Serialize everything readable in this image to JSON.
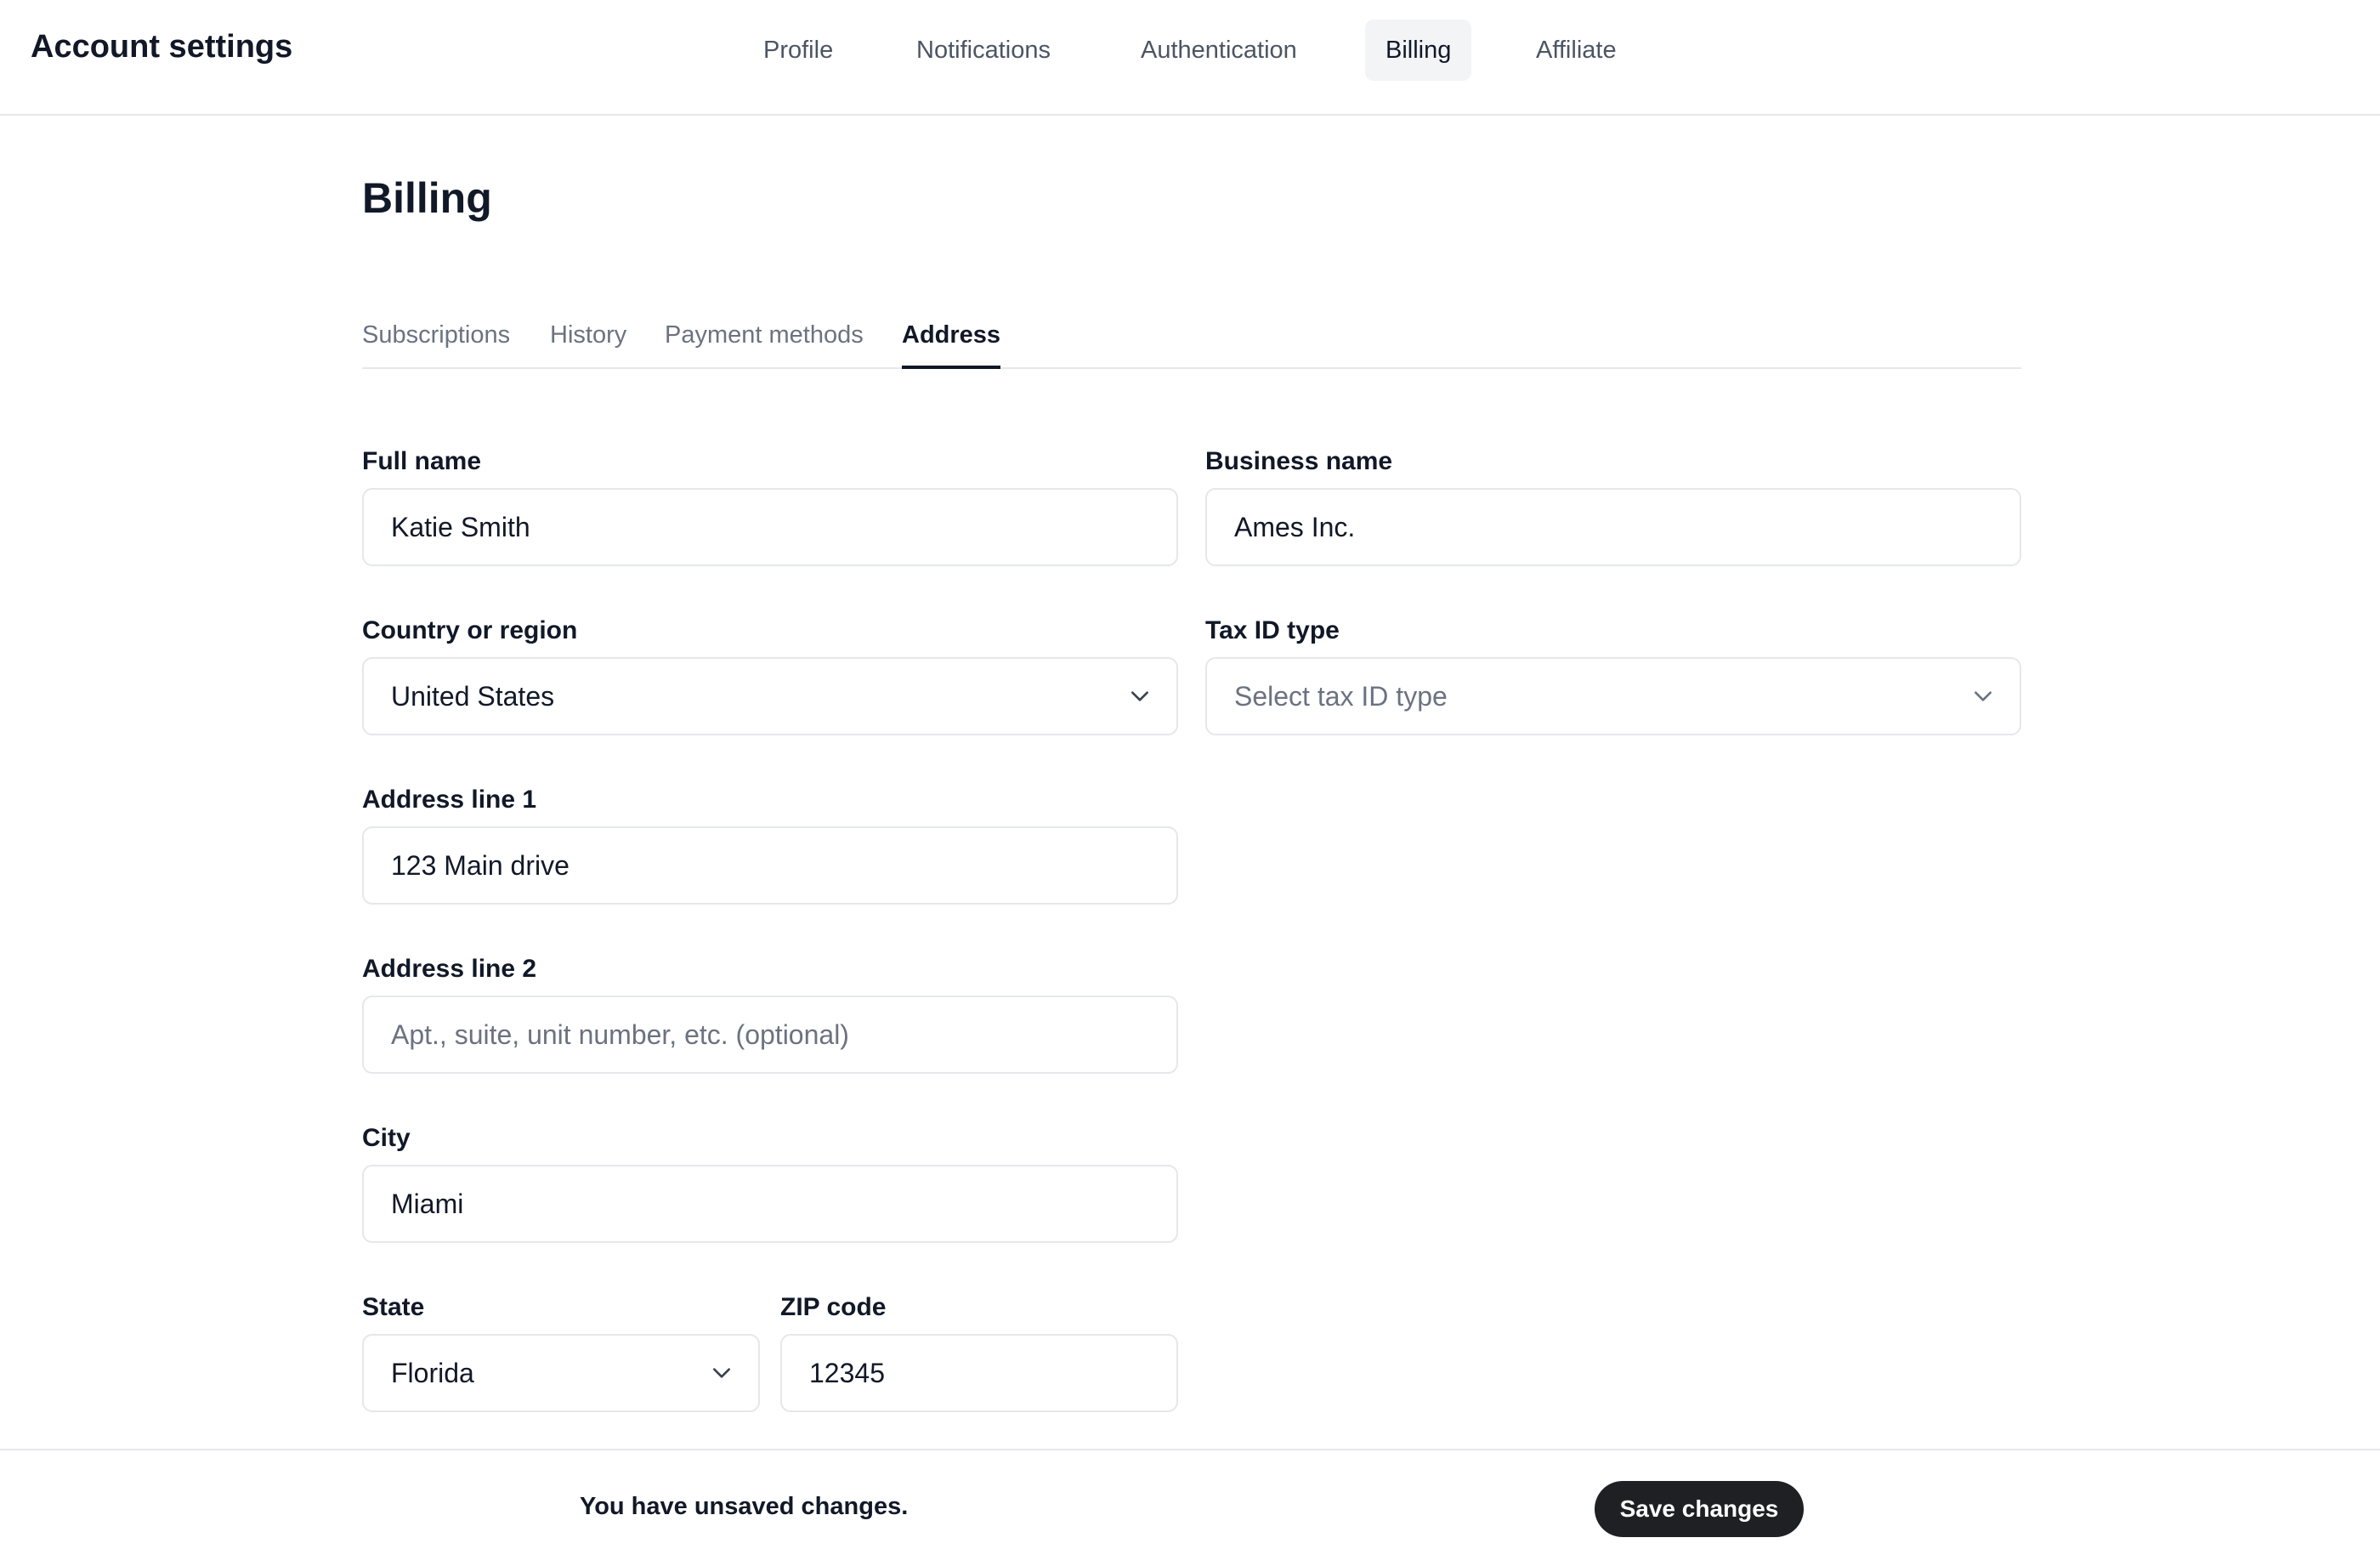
{
  "header": {
    "title": "Account settings",
    "nav": [
      {
        "label": "Profile",
        "active": false
      },
      {
        "label": "Notifications",
        "active": false
      },
      {
        "label": "Authentication",
        "active": false
      },
      {
        "label": "Billing",
        "active": true
      },
      {
        "label": "Affiliate",
        "active": false
      }
    ]
  },
  "page": {
    "title": "Billing",
    "tabs": [
      {
        "label": "Subscriptions",
        "active": false
      },
      {
        "label": "History",
        "active": false
      },
      {
        "label": "Payment methods",
        "active": false
      },
      {
        "label": "Address",
        "active": true
      }
    ]
  },
  "form": {
    "full_name": {
      "label": "Full name",
      "value": "Katie Smith"
    },
    "business_name": {
      "label": "Business name",
      "value": "Ames Inc."
    },
    "country": {
      "label": "Country or region",
      "value": "United States"
    },
    "tax_id_type": {
      "label": "Tax ID type",
      "placeholder": "Select tax ID type"
    },
    "address_line_1": {
      "label": "Address line 1",
      "value": "123 Main drive"
    },
    "address_line_2": {
      "label": "Address line 2",
      "placeholder": "Apt., suite, unit number, etc. (optional)"
    },
    "city": {
      "label": "City",
      "value": "Miami"
    },
    "state": {
      "label": "State",
      "value": "Florida"
    },
    "zip": {
      "label": "ZIP code",
      "value": "12345"
    }
  },
  "footer": {
    "message": "You have unsaved changes.",
    "save_label": "Save changes"
  },
  "colors": {
    "primary_button": "#1f2023",
    "border": "#e5e7eb",
    "active_nav_bg": "#f3f4f6"
  }
}
